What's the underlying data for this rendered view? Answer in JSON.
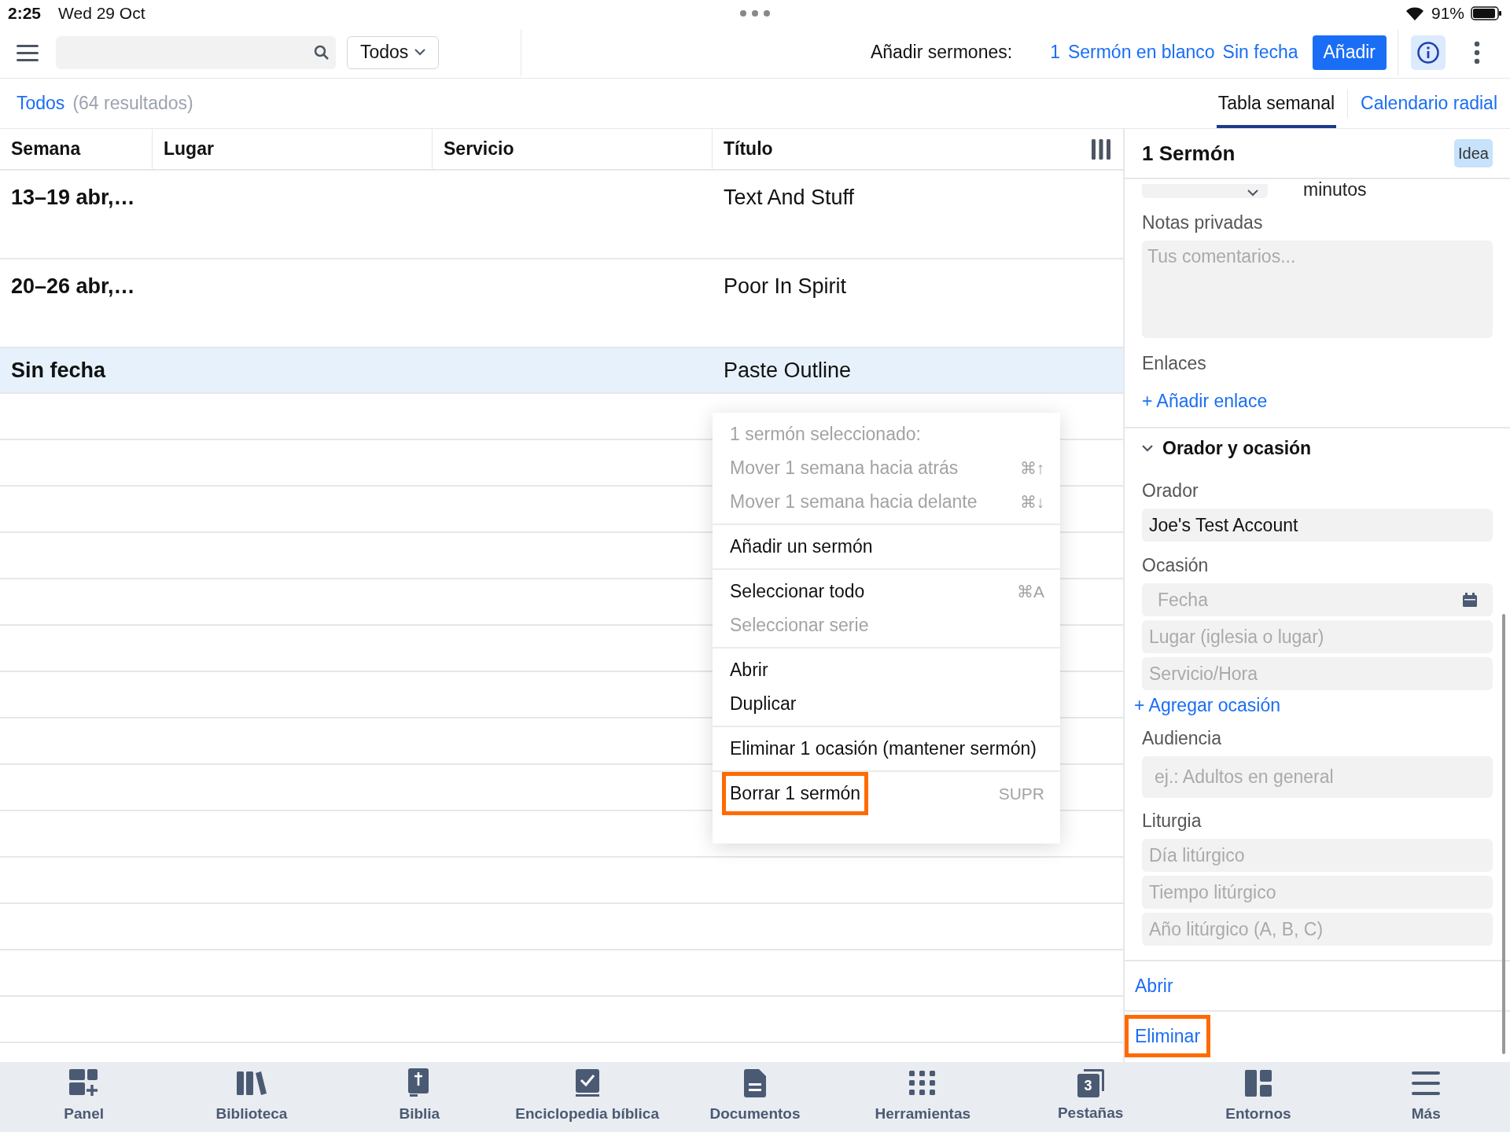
{
  "status_bar": {
    "time": "2:25",
    "date": "Wed 29 Oct",
    "battery": "91%"
  },
  "toolbar": {
    "filter": "Todos",
    "add_label": "Añadir sermones:",
    "count": "1",
    "blank": "Sermón en blanco",
    "no_date": "Sin fecha",
    "add_button": "Añadir"
  },
  "filter_bar": {
    "scope": "Todos",
    "results": "(64 resultados)",
    "view_tabs": [
      {
        "label": "Tabla semanal",
        "selected": true
      },
      {
        "label": "Calendario radial",
        "selected": false
      }
    ]
  },
  "table": {
    "columns": [
      "Semana",
      "Lugar",
      "Servicio",
      "Título"
    ],
    "rows": [
      {
        "semana": "13–19 abr,…",
        "titulo": "Text And Stuff",
        "selected": false,
        "kind": "tall"
      },
      {
        "semana": "20–26 abr,…",
        "titulo": "Poor In Spirit",
        "selected": false,
        "kind": "tall"
      },
      {
        "semana": "Sin fecha",
        "titulo": "Paste Outline",
        "selected": true,
        "kind": "short"
      }
    ]
  },
  "context_menu": {
    "sections": [
      [
        {
          "label": "1 sermón seleccionado:",
          "disabled": true
        },
        {
          "label": "Mover 1 semana hacia atrás",
          "shortcut": "⌘↑",
          "disabled": true
        },
        {
          "label": "Mover 1 semana hacia delante",
          "shortcut": "⌘↓",
          "disabled": true
        }
      ],
      [
        {
          "label": "Añadir un sermón",
          "disabled": false
        }
      ],
      [
        {
          "label": "Seleccionar todo",
          "shortcut": "⌘A",
          "disabled": false
        },
        {
          "label": "Seleccionar serie",
          "disabled": true
        }
      ],
      [
        {
          "label": "Abrir",
          "disabled": false
        },
        {
          "label": "Duplicar",
          "disabled": false
        }
      ],
      [
        {
          "label": "Eliminar 1 ocasión (mantener sermón)",
          "disabled": false
        }
      ],
      [
        {
          "label": "Borrar 1 sermón",
          "shortcut": "SUPR",
          "disabled": false,
          "highlighted": true
        }
      ]
    ]
  },
  "detail": {
    "title": "1 Sermón",
    "badge": "Idea",
    "duration_unit": "minutos",
    "notes": {
      "label": "Notas privadas",
      "placeholder": "Tus comentarios..."
    },
    "links": {
      "label": "Enlaces",
      "add": "+ Añadir enlace"
    },
    "section": {
      "title": "Orador y ocasión",
      "expanded": true
    },
    "speaker": {
      "label": "Orador",
      "value": "Joe's Test Account"
    },
    "occasion": {
      "label": "Ocasión",
      "fields": [
        {
          "placeholder": "Fecha",
          "kind": "date"
        },
        {
          "placeholder": "Lugar (iglesia o lugar)",
          "kind": "text"
        },
        {
          "placeholder": "Servicio/Hora",
          "kind": "text"
        }
      ],
      "add": "+ Agregar ocasión"
    },
    "audience": {
      "label": "Audiencia",
      "placeholder": "ej.: Adultos en general"
    },
    "liturgy": {
      "label": "Liturgia",
      "fields": [
        {
          "placeholder": "Día litúrgico"
        },
        {
          "placeholder": "Tiempo litúrgico"
        },
        {
          "placeholder": "Año litúrgico (A, B, C)"
        }
      ]
    },
    "actions": [
      {
        "label": "Abrir",
        "highlighted": false
      },
      {
        "label": "Eliminar",
        "highlighted": true
      }
    ]
  },
  "tab_bar": [
    {
      "label": "Panel",
      "kind": "panel"
    },
    {
      "label": "Biblioteca",
      "kind": "library"
    },
    {
      "label": "Biblia",
      "kind": "bible"
    },
    {
      "label": "Enciclopedia bíblica",
      "kind": "encyclopedia"
    },
    {
      "label": "Documentos",
      "kind": "documents"
    },
    {
      "label": "Herramientas",
      "kind": "tools"
    },
    {
      "label": "Pestañas",
      "kind": "tabs",
      "badge": "3"
    },
    {
      "label": "Entornos",
      "kind": "layouts"
    },
    {
      "label": "Más",
      "kind": "more"
    }
  ]
}
